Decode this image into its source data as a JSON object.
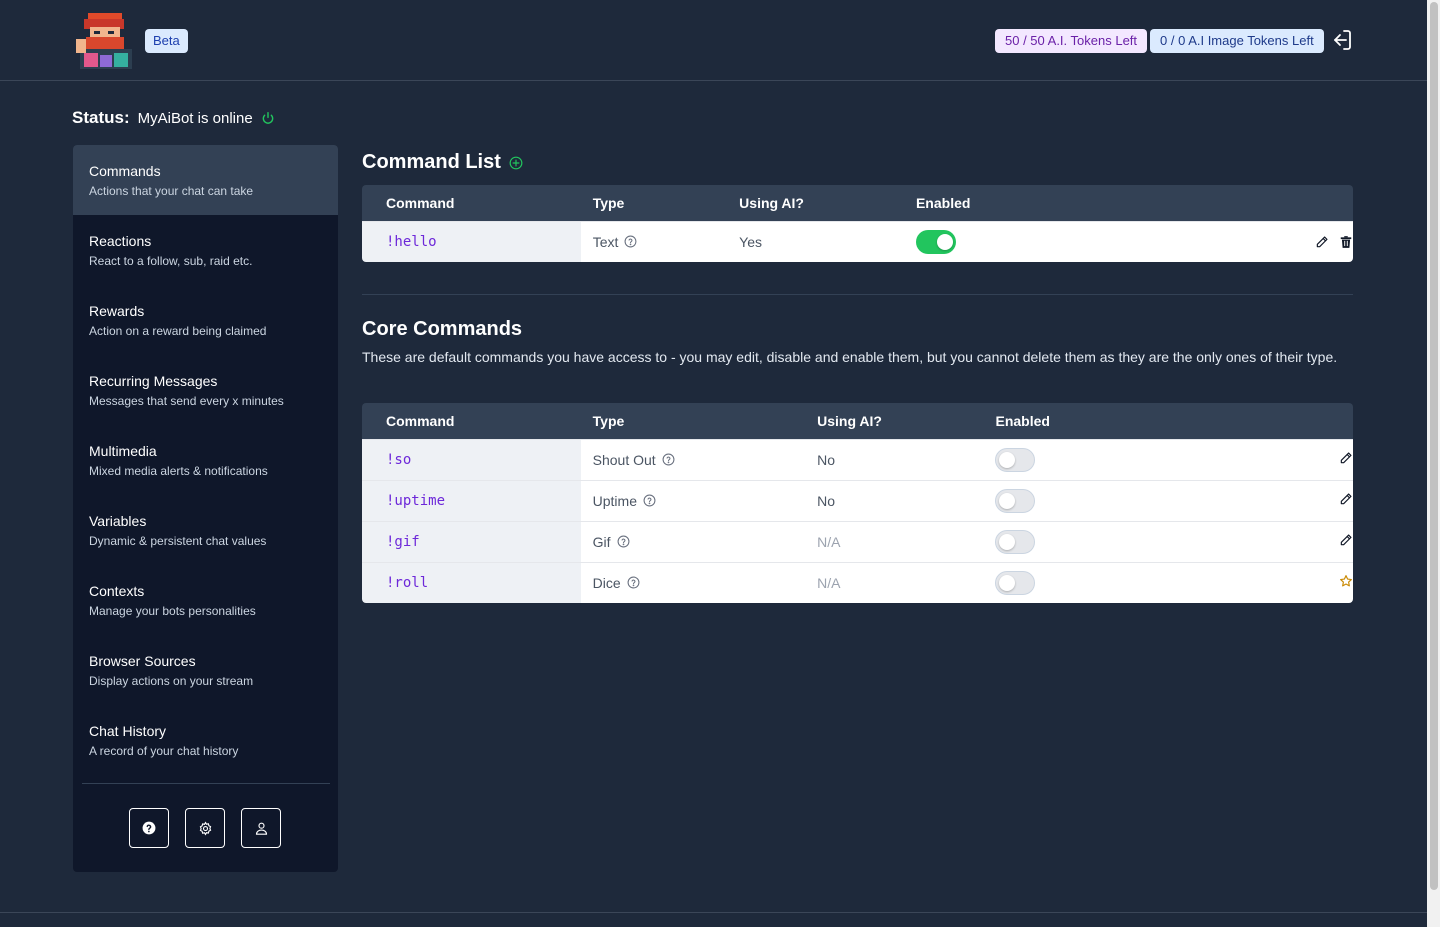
{
  "header": {
    "beta_label": "Beta",
    "ai_tokens": "50 / 50 A.I. Tokens Left",
    "image_tokens": "0 / 0 A.I Image Tokens Left"
  },
  "status": {
    "label": "Status:",
    "text": "MyAiBot is online"
  },
  "sidebar": {
    "items": [
      {
        "title": "Commands",
        "subtitle": "Actions that your chat can take",
        "active": true
      },
      {
        "title": "Reactions",
        "subtitle": "React to a follow, sub, raid etc."
      },
      {
        "title": "Rewards",
        "subtitle": "Action on a reward being claimed"
      },
      {
        "title": "Recurring Messages",
        "subtitle": "Messages that send every x minutes"
      },
      {
        "title": "Multimedia",
        "subtitle": "Mixed media alerts & notifications"
      },
      {
        "title": "Variables",
        "subtitle": "Dynamic & persistent chat values"
      },
      {
        "title": "Contexts",
        "subtitle": "Manage your bots personalities"
      },
      {
        "title": "Browser Sources",
        "subtitle": "Display actions on your stream"
      },
      {
        "title": "Chat History",
        "subtitle": "A record of your chat history"
      }
    ],
    "footer_icons": [
      "help-icon",
      "settings-icon",
      "user-icon"
    ]
  },
  "command_list": {
    "title": "Command List",
    "headers": {
      "command": "Command",
      "type": "Type",
      "ai": "Using AI?",
      "enabled": "Enabled"
    },
    "rows": [
      {
        "command": "!hello",
        "type": "Text",
        "ai": "Yes",
        "enabled": true
      }
    ]
  },
  "core_commands": {
    "title": "Core Commands",
    "description": "These are default commands you have access to - you may edit, disable and enable them, but you cannot delete them as they are the only ones of their type.",
    "headers": {
      "command": "Command",
      "type": "Type",
      "ai": "Using AI?",
      "enabled": "Enabled"
    },
    "rows": [
      {
        "command": "!so",
        "type": "Shout Out",
        "ai": "No",
        "enabled": false,
        "action": "edit"
      },
      {
        "command": "!uptime",
        "type": "Uptime",
        "ai": "No",
        "enabled": false,
        "action": "edit"
      },
      {
        "command": "!gif",
        "type": "Gif",
        "ai": "N/A",
        "enabled": false,
        "action": "edit"
      },
      {
        "command": "!roll",
        "type": "Dice",
        "ai": "N/A",
        "enabled": false,
        "action": "star"
      }
    ]
  },
  "colors": {
    "background": "#1e293b",
    "sidebar": "#0f172a",
    "accent_green": "#22c55e",
    "command_purple": "#6d28d9",
    "star": "#ca8a04"
  }
}
